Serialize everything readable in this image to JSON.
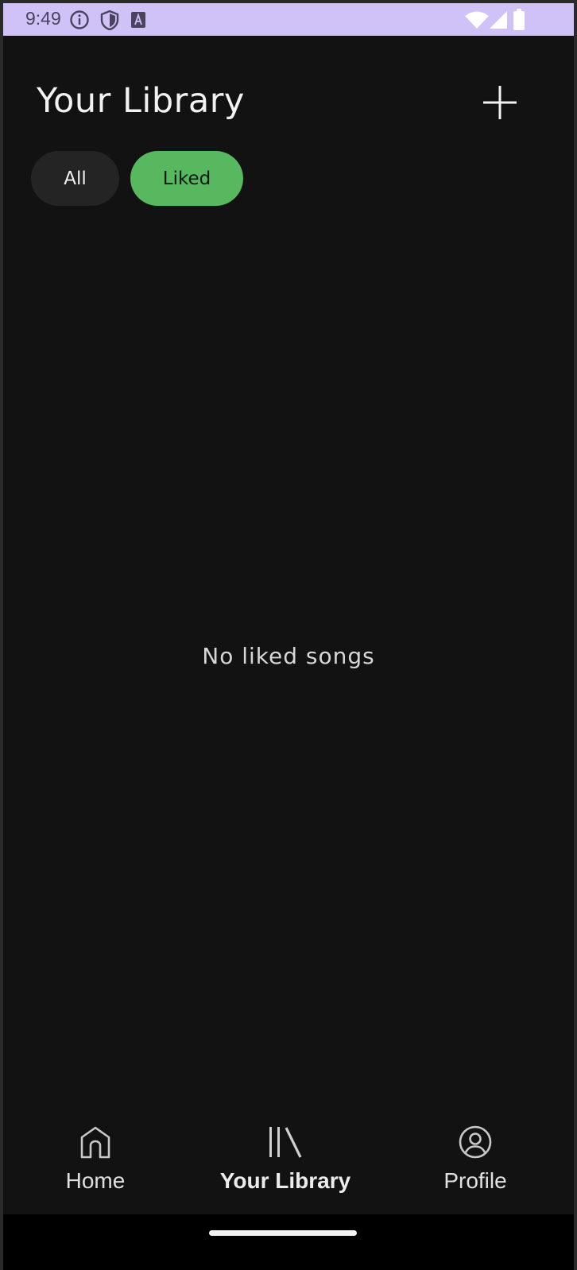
{
  "status_bar": {
    "time": "9:49",
    "left_icons": [
      "info-icon",
      "shield-icon",
      "font-icon"
    ],
    "right_icons": [
      "wifi-icon",
      "cellular-icon",
      "battery-icon"
    ]
  },
  "header": {
    "title": "Your Library",
    "add_icon": "plus-icon"
  },
  "filters": {
    "all_label": "All",
    "liked_label": "Liked",
    "selected": "Liked"
  },
  "empty_state": {
    "message": "No liked songs"
  },
  "bottom_nav": {
    "items": [
      {
        "label": "Home",
        "icon": "home-icon",
        "active": false
      },
      {
        "label": "Your Library",
        "icon": "library-icon",
        "active": true
      },
      {
        "label": "Profile",
        "icon": "profile-icon",
        "active": false
      }
    ]
  },
  "colors": {
    "background": "#121212",
    "status_bar": "#d0c1f6",
    "accent": "#58b860",
    "chip_inactive": "#242424"
  }
}
